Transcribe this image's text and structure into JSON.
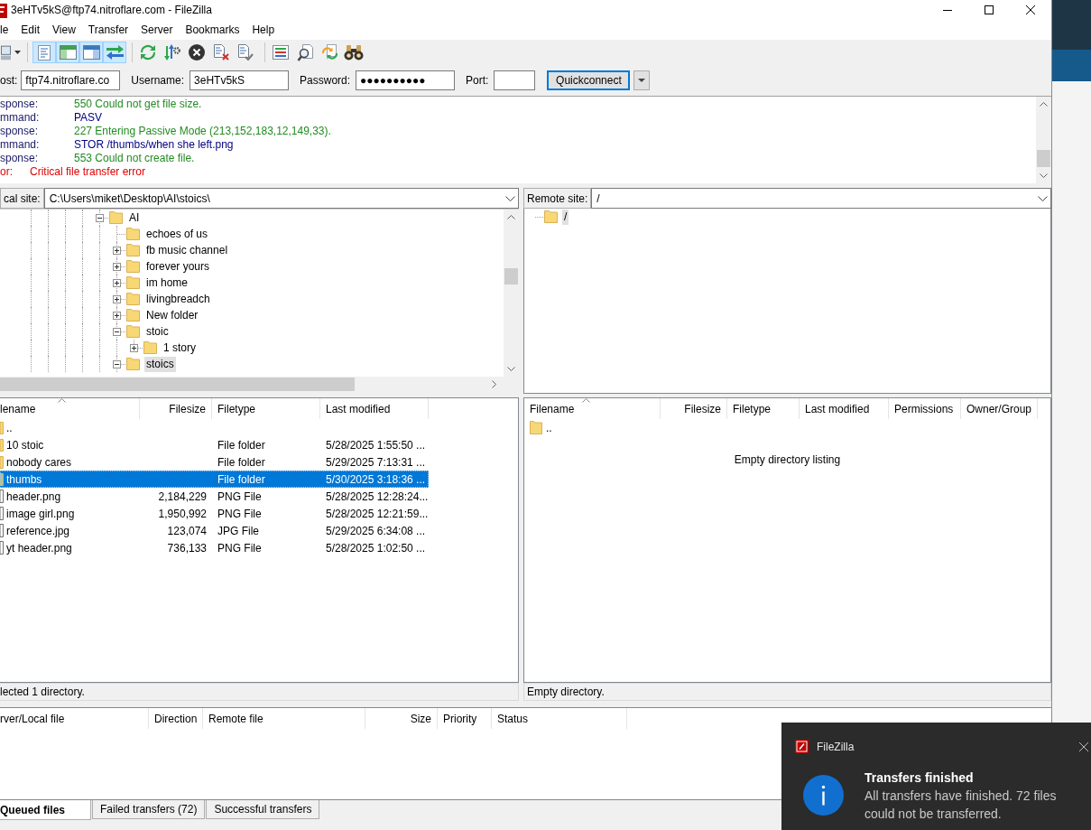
{
  "window": {
    "title": "3eHTv5kS@ftp74.nitroflare.com - FileZilla"
  },
  "menu": [
    "le",
    "Edit",
    "View",
    "Transfer",
    "Server",
    "Bookmarks",
    "Help"
  ],
  "toolbar": {
    "view_toggles": [
      {
        "on": true
      },
      {
        "on": true
      },
      {
        "on": true
      },
      {
        "on": true
      }
    ]
  },
  "quickconnect": {
    "host_label": "ost:",
    "host": "ftp74.nitroflare.co",
    "username_label": "Username:",
    "username": "3eHTv5kS",
    "password_label": "Password:",
    "password": "●●●●●●●●●●",
    "port_label": "Port:",
    "button": "Quickconnect"
  },
  "message_log": [
    {
      "kind": "response",
      "label": "sponse:",
      "text": "550 Could not get file size."
    },
    {
      "kind": "command",
      "label": "mmand:",
      "text": "PASV"
    },
    {
      "kind": "response",
      "label": "sponse:",
      "text": "227 Entering Passive Mode (213,152,183,12,149,33)."
    },
    {
      "kind": "command",
      "label": "mmand:",
      "text": "STOR /thumbs/when she left.png"
    },
    {
      "kind": "response",
      "label": "sponse:",
      "text": "553 Could not create file."
    },
    {
      "kind": "error",
      "label": "or:",
      "text": "Critical file transfer error"
    }
  ],
  "local_site": {
    "label": "cal site:",
    "path": "C:\\Users\\miket\\Desktop\\AI\\stoics\\",
    "tree": [
      {
        "label": "AI",
        "expandable": true,
        "expanded": true,
        "selected": false,
        "children": [
          {
            "label": "echoes of us",
            "expandable": false,
            "selected": false
          },
          {
            "label": "fb music channel",
            "expandable": true,
            "expanded": false,
            "selected": false
          },
          {
            "label": "forever yours",
            "expandable": true,
            "expanded": false,
            "selected": false
          },
          {
            "label": "im home",
            "expandable": true,
            "expanded": false,
            "selected": false
          },
          {
            "label": "livingbreadch",
            "expandable": true,
            "expanded": false,
            "selected": false
          },
          {
            "label": "New folder",
            "expandable": true,
            "expanded": false,
            "selected": false
          },
          {
            "label": "stoic",
            "expandable": true,
            "expanded": true,
            "selected": false,
            "children": [
              {
                "label": "1 story",
                "expandable": true,
                "expanded": false,
                "selected": false
              }
            ]
          },
          {
            "label": "stoics",
            "expandable": true,
            "expanded": true,
            "selected": true
          }
        ]
      }
    ]
  },
  "remote_site": {
    "label": "Remote site:",
    "path": "/",
    "tree": [
      {
        "label": "/",
        "expandable": false,
        "selected": true
      }
    ]
  },
  "local_files": {
    "columns": [
      "lename",
      "Filesize",
      "Filetype",
      "Last modified"
    ],
    "rows": [
      {
        "kind": "folder",
        "name": "..",
        "selected": false
      },
      {
        "kind": "folder",
        "name": "10 stoic",
        "type": "File folder",
        "modified": "5/28/2025 1:55:50 ...",
        "selected": false
      },
      {
        "kind": "folder",
        "name": "nobody cares",
        "type": "File folder",
        "modified": "5/29/2025 7:13:31 ...",
        "selected": false
      },
      {
        "kind": "folder",
        "name": "thumbs",
        "type": "File folder",
        "modified": "5/30/2025 3:18:36 ...",
        "selected": true
      },
      {
        "kind": "file",
        "name": "header.png",
        "size": "2,184,229",
        "type": "PNG File",
        "modified": "5/28/2025 12:28:24...",
        "selected": false
      },
      {
        "kind": "file",
        "name": "image girl.png",
        "size": "1,950,992",
        "type": "PNG File",
        "modified": "5/28/2025 12:21:59...",
        "selected": false
      },
      {
        "kind": "file",
        "name": "reference.jpg",
        "size": "123,074",
        "type": "JPG File",
        "modified": "5/29/2025 6:34:08 ...",
        "selected": false
      },
      {
        "kind": "file",
        "name": "yt header.png",
        "size": "736,133",
        "type": "PNG File",
        "modified": "5/28/2025 1:02:50 ...",
        "selected": false
      }
    ],
    "status": "lected 1 directory."
  },
  "remote_files": {
    "columns": [
      "Filename",
      "Filesize",
      "Filetype",
      "Last modified",
      "Permissions",
      "Owner/Group"
    ],
    "rows": [
      {
        "kind": "folder",
        "name": "..",
        "selected": false
      }
    ],
    "empty_message": "Empty directory listing",
    "status": "Empty directory."
  },
  "queue": {
    "columns": [
      "rver/Local file",
      "Direction",
      "Remote file",
      "Size",
      "Priority",
      "Status"
    ],
    "tabs": [
      {
        "label": "Queued files",
        "selected": true
      },
      {
        "label": "Failed transfers (72)",
        "selected": false
      },
      {
        "label": "Successful transfers",
        "selected": false
      }
    ]
  },
  "notification": {
    "app": "FileZilla",
    "title": "Transfers finished",
    "message": "All transfers have finished. 72 files could not be transferred."
  }
}
